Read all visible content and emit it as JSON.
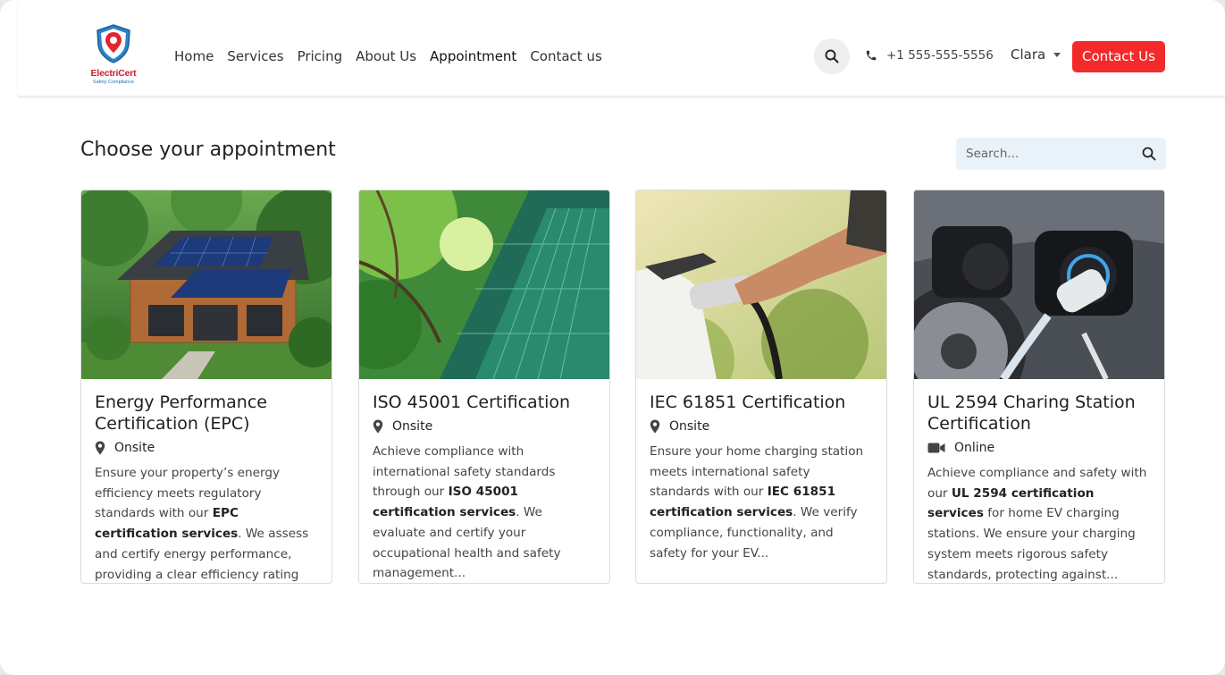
{
  "brand": {
    "name": "ElectriCert",
    "tagline": "Safety Compliance"
  },
  "nav": {
    "items": [
      {
        "label": "Home"
      },
      {
        "label": "Services"
      },
      {
        "label": "Pricing"
      },
      {
        "label": "About Us"
      },
      {
        "label": "Appointment",
        "active": true
      },
      {
        "label": "Contact us"
      }
    ]
  },
  "header": {
    "phone": "+1 555-555-5556",
    "user": "Clara",
    "contact_button": "Contact Us"
  },
  "page": {
    "title": "Choose your appointment",
    "search_placeholder": "Search..."
  },
  "cards": [
    {
      "title": "Energy Performance Certification (EPC)",
      "mode": "Onsite",
      "mode_icon": "map-pin-icon",
      "desc_pre": "Ensure your property’s energy efficiency meets regulatory standards with our ",
      "desc_bold": "EPC certification services",
      "desc_post": ". We assess and certify energy performance, providing a clear efficiency rating an..."
    },
    {
      "title": "ISO 45001 Certification",
      "mode": "Onsite",
      "mode_icon": "map-pin-icon",
      "desc_pre": "Achieve compliance with international safety standards through our ",
      "desc_bold": "ISO 45001 certification services",
      "desc_post": ". We evaluate and certify your occupational health and safety management..."
    },
    {
      "title": "IEC 61851 Certification",
      "mode": "Onsite",
      "mode_icon": "map-pin-icon",
      "desc_pre": "Ensure your home charging station meets international safety standards with our ",
      "desc_bold": "IEC 61851 certification services",
      "desc_post": ". We verify compliance, functionality, and safety for your EV..."
    },
    {
      "title": "UL 2594 Charing Station Certification",
      "mode": "Online",
      "mode_icon": "video-camera-icon",
      "desc_pre": "Achieve compliance and safety with our ",
      "desc_bold": "UL 2594 certification services",
      "desc_post": " for home EV charging stations. We ensure your charging system meets rigorous safety standards, protecting against..."
    }
  ],
  "colors": {
    "accent": "#f42a2a",
    "search_bg": "#e9f2f8",
    "logo_red": "#c8202f",
    "logo_blue": "#2a6fb4"
  }
}
